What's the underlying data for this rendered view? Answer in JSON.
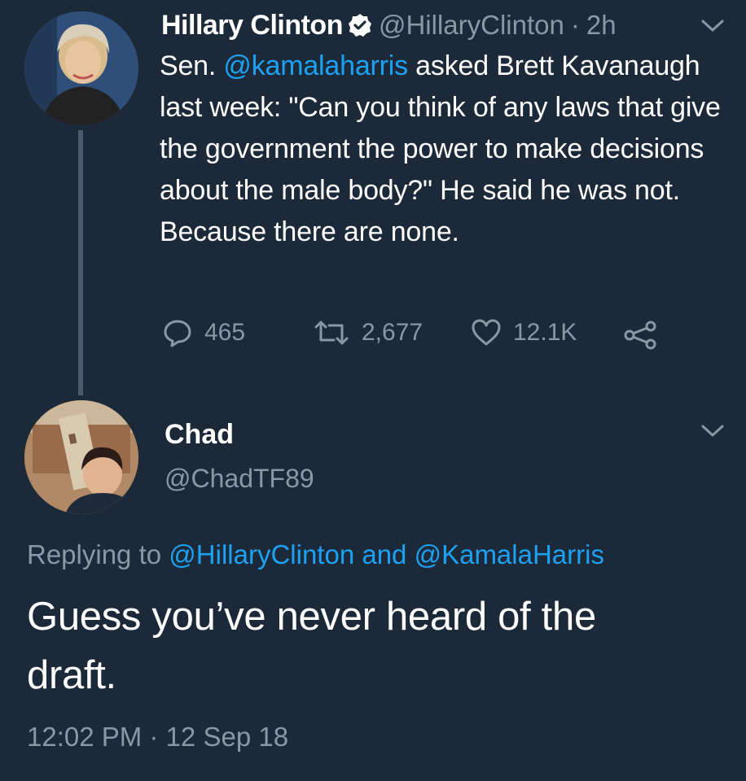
{
  "tweet1": {
    "author_name": "Hillary Clinton",
    "handle": "@HillaryClinton",
    "separator": "·",
    "time": "2h",
    "text_prefix": "Sen. ",
    "mention": "@kamalaharris",
    "text_rest": " asked Brett Kavanaugh last week: \"Can you think of any laws that give the government the power to make decisions about the male body?\" He said he was not. Because there are none.",
    "reply_count": "465",
    "retweet_count": "2,677",
    "like_count": "12.1K"
  },
  "tweet2": {
    "author_name": "Chad",
    "handle": "@ChadTF89",
    "replying_label": "Replying to",
    "replying_to_1": "@HillaryClinton",
    "replying_and": "and",
    "replying_to_2": "@KamalaHarris",
    "text": "Guess you’ve never heard of the draft.",
    "timestamp": "12:02 PM · 12 Sep 18"
  },
  "colors": {
    "background": "#1c2938",
    "link": "#1da1f2",
    "muted": "#8899a6"
  },
  "icons": [
    "verified-badge-icon",
    "chevron-down-icon",
    "reply-icon",
    "retweet-icon",
    "like-icon",
    "share-icon"
  ]
}
